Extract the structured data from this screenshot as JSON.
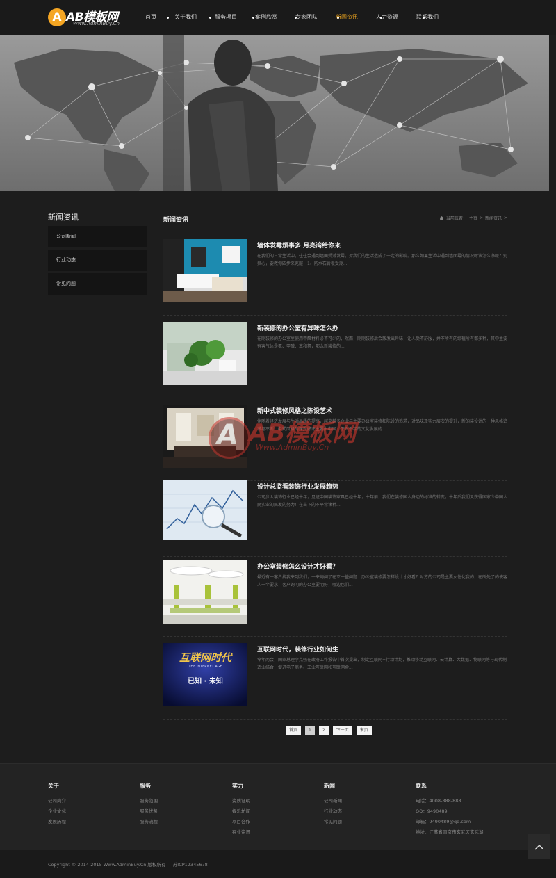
{
  "brand": {
    "logo_letter": "A",
    "logo_text": "AB模板网",
    "logo_sub": "Www.AdminBuy.Cn",
    "accent_color": "#f0a71e"
  },
  "nav": {
    "items": [
      {
        "label": "首页"
      },
      {
        "label": "关于我们"
      },
      {
        "label": "服务项目"
      },
      {
        "label": "案例欣赏"
      },
      {
        "label": "专家团队"
      },
      {
        "label": "新闻资讯",
        "active": true
      },
      {
        "label": "人力资源"
      },
      {
        "label": "联系我们"
      }
    ]
  },
  "sidebar": {
    "title": "新闻资讯",
    "items": [
      {
        "label": "公司新闻"
      },
      {
        "label": "行业动态"
      },
      {
        "label": "常见问题"
      }
    ]
  },
  "main": {
    "title": "新闻资讯",
    "breadcrumb": {
      "prefix": "当前位置：",
      "home": "主页",
      "sep": ">",
      "current": "新闻资讯",
      "tail": ">"
    }
  },
  "articles": [
    {
      "title": "墙体发霉烦事多 月亮湾给你来",
      "desc": "在我们的日常生活中，往往会遇到墙面受潮发霉，对我们的生活造成了一定的影响。那么如果生活中遇到墙面霉的情况时该怎么办呢？别担心，要教你四步来克服！1、防水石膏板受潮...",
      "thumb": "bedroom"
    },
    {
      "title": "新装修的办公室有异味怎么办",
      "desc": "在刚装修的办公室里使用甲醛材料必不可少的，然而，刚刚装修后会散发出异味，让人受不舒服，并不所有的绿植所有都多种，其中主要有害气体是氨、甲醛、苯和氡，那么新装修的...",
      "thumb": "plants"
    },
    {
      "title": "新中式装修风格之陈设艺术",
      "desc": "伴随着经济发展与生活品质的提高，越来越多企业与主要办公室装修和陈设的追求，对品味及实力层次的提升，新的装设计的一种风格追求与不断...中式风格的深受好评主要由中国上下五千年的文化发展的...",
      "thumb": "chinese"
    },
    {
      "title": "设计总监看装饰行业发展趋势",
      "desc": "公司步入装饰行业已经十年，见证中国装饰家具已经十年，十年前，我们在装修国人身边的标准的转变，十年后我们又获得国家少中国人民实业的民发的努力！在当下的不平常诸种...",
      "thumb": "chart"
    },
    {
      "title": "办公室装修怎么设计才好看？",
      "desc": "最近有一客户找我来到我们，一来询问了在立一些问题：办公室装修要怎样设计才好看？对方的公司是主要女性化我的，在所处了的使客人一个要求，客户询问的办公室要明好，哪边也们...",
      "thumb": "office"
    },
    {
      "title": "互联网时代，装修行业如何生",
      "desc": "今年两会，国家总理李克强在政府工作报告中首次提出，制定互联网+行动计划，推动移动互联网、云计算、大数据、物联网等与现代制造业结合，促进电子商务、工业互联网和互联网金...",
      "thumb": "internet",
      "thumb_text": {
        "big": "互联网时代",
        "sub": "THE INTERNET AGE",
        "mid": "已知 · 未知"
      }
    }
  ],
  "pagination": {
    "first": "首页",
    "pages": [
      "1",
      "2"
    ],
    "current": "1",
    "next": "下一页",
    "last": "末页"
  },
  "footer": {
    "columns": [
      {
        "head": "关于",
        "links": [
          "公司简介",
          "企业文化",
          "发展历程"
        ]
      },
      {
        "head": "服务",
        "links": [
          "服务范围",
          "服务优势",
          "服务流程"
        ]
      },
      {
        "head": "实力",
        "links": [
          "资质证明",
          "娱乐坊间",
          "项目合作",
          "在业资讯"
        ]
      },
      {
        "head": "新闻",
        "links": [
          "公司新闻",
          "行业动态",
          "常见问题"
        ]
      },
      {
        "head": "联系",
        "links": [
          "电话：4008-888-888",
          "QQ：9490489",
          "邮箱：9490489@qq.com",
          "地址：江苏省南京市玄武区玄武湖"
        ]
      }
    ],
    "copyright": "Copyright © 2014-2015 Www.AdminBuy.Cn 版权所有",
    "icp": "苏ICP12345678"
  },
  "watermark": {
    "letter": "A",
    "text": "AB模板网",
    "sub": "Www.AdminBuy.Cn"
  }
}
